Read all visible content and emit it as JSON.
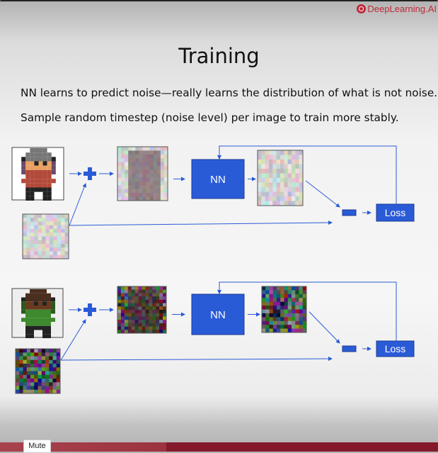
{
  "brand": {
    "name": "DeepLearning.AI",
    "color": "#c0283a"
  },
  "slide": {
    "title": "Training",
    "line1": "NN learns to predict noise—really learns the distribution of what is not noise.",
    "line2": "Sample random timestep (noise level) per image to train more stably."
  },
  "diagram": {
    "accent_color": "#2a5bd7",
    "rows": [
      {
        "noise_level": "low",
        "nn_label": "NN",
        "loss_label": "Loss",
        "sprite": "character-grey-helmet"
      },
      {
        "noise_level": "high",
        "nn_label": "NN",
        "loss_label": "Loss",
        "sprite": "character-green-shirt"
      }
    ]
  },
  "player": {
    "mute_tooltip": "Mute",
    "progress_color": "#83192a"
  }
}
